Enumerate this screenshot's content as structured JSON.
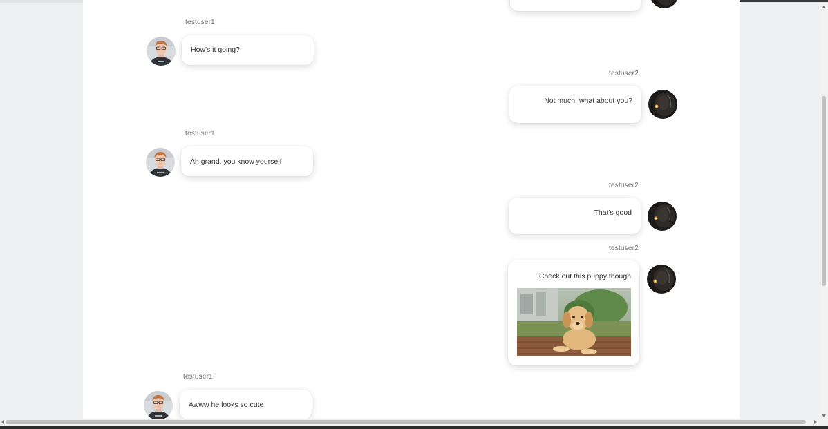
{
  "messages": [
    {
      "user": "testuser1",
      "text": "How's it going?"
    },
    {
      "user": "testuser2",
      "text": "Not much, what about you?"
    },
    {
      "user": "testuser1",
      "text": "Ah grand, you know yourself"
    },
    {
      "user": "testuser2",
      "text": "That's good"
    },
    {
      "user": "testuser2",
      "text": "Check out this puppy though",
      "attachment": "puppy-photo"
    },
    {
      "user": "testuser1",
      "text": "Awww he looks so cute"
    }
  ],
  "icons": {
    "user1_avatar": "person-avatar",
    "user2_avatar": "dark-avatar",
    "image": "puppy-photo"
  },
  "colors": {
    "panel": "#ffffff",
    "background": "#eff0f1",
    "username": "#707070",
    "text": "#333333"
  }
}
